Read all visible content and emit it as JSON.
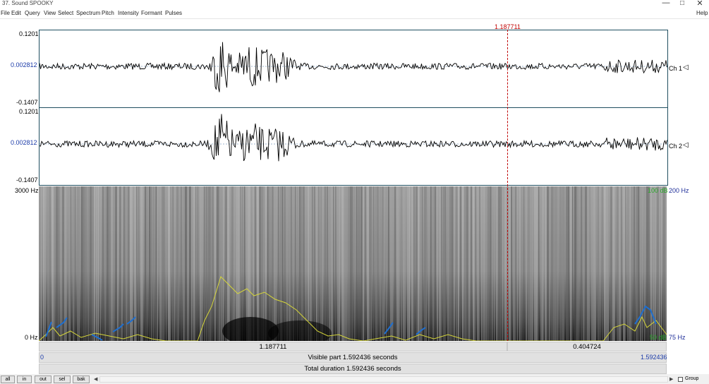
{
  "window": {
    "title": "37. Sound SPOOKY"
  },
  "menu": {
    "items": [
      "File",
      "Edit",
      "Query",
      "View",
      "Select",
      "Spectrum",
      "Pitch",
      "Intensity",
      "Formant",
      "Pulses"
    ],
    "help": "Help"
  },
  "waveform": {
    "channels": [
      {
        "label": "Ch 1",
        "max": "0.1201",
        "mid": "0.002812",
        "min": "-0.1407"
      },
      {
        "label": "Ch 2",
        "max": "0.1201",
        "mid": "0.002812",
        "min": "-0.1407"
      }
    ]
  },
  "cursor": {
    "time": "1.187711",
    "color": "#c00000"
  },
  "spectrogram": {
    "freq_max": "3000 Hz",
    "freq_min": "0 Hz",
    "pitch_max": "200 Hz",
    "pitch_min": "75 Hz",
    "db_max": "100 dB",
    "db_min": "50 dB"
  },
  "timebar": {
    "left_segment": "1.187711",
    "right_segment": "0.404724"
  },
  "visible_bar": {
    "start": "0",
    "text": "Visible part 1.592436 seconds",
    "end": "1.592436"
  },
  "total_bar": {
    "text": "Total duration 1.592436 seconds"
  },
  "buttons": [
    "all",
    "in",
    "out",
    "sel",
    "bak"
  ],
  "group": {
    "label": "Group"
  },
  "colors": {
    "frame": "#1f4e60",
    "cursor": "#c00000",
    "pitch": "#1e6fd0",
    "intensity": "#d6d63a",
    "navy_text": "#1f2e99"
  }
}
